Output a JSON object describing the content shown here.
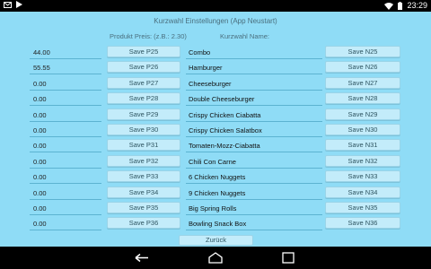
{
  "status": {
    "time": "23:29"
  },
  "title": "Kurzwahl Einstellungen (App Neustart)",
  "headers": {
    "price": "Produkt Preis: (z.B.: 2.30)",
    "name": "Kurzwahl Name:"
  },
  "rows": [
    {
      "price": "44.00",
      "p_button": "Save P25",
      "name": "Combo",
      "n_button": "Save N25"
    },
    {
      "price": "55.55",
      "p_button": "Save P26",
      "name": "Hamburger",
      "n_button": "Save N26"
    },
    {
      "price": "0.00",
      "p_button": "Save P27",
      "name": "Cheeseburger",
      "n_button": "Save N27"
    },
    {
      "price": "0.00",
      "p_button": "Save P28",
      "name": "Double Cheeseburger",
      "n_button": "Save N28"
    },
    {
      "price": "0.00",
      "p_button": "Save P29",
      "name": "Crispy Chicken Ciabatta",
      "n_button": "Save N29"
    },
    {
      "price": "0.00",
      "p_button": "Save P30",
      "name": "Crispy Chicken Salatbox",
      "n_button": "Save N30"
    },
    {
      "price": "0.00",
      "p_button": "Save P31",
      "name": "Tomaten-Mozz-Ciabatta",
      "n_button": "Save N31"
    },
    {
      "price": "0.00",
      "p_button": "Save P32",
      "name": "Chili Con Carne",
      "n_button": "Save N32"
    },
    {
      "price": "0.00",
      "p_button": "Save P33",
      "name": "6 Chicken Nuggets",
      "n_button": "Save N33"
    },
    {
      "price": "0.00",
      "p_button": "Save P34",
      "name": "9 Chicken Nuggets",
      "n_button": "Save N34"
    },
    {
      "price": "0.00",
      "p_button": "Save P35",
      "name": "Big Spring Rolls",
      "n_button": "Save N35"
    },
    {
      "price": "0.00",
      "p_button": "Save P36",
      "name": "Bowling Snack Box",
      "n_button": "Save N36"
    }
  ],
  "back_button": "Zurück",
  "icons": {
    "status_left": [
      "mail-icon",
      "play-store-icon"
    ],
    "status_right": [
      "wifi-icon",
      "battery-icon"
    ],
    "nav": [
      "back-icon",
      "home-icon",
      "recent-apps-icon"
    ]
  }
}
